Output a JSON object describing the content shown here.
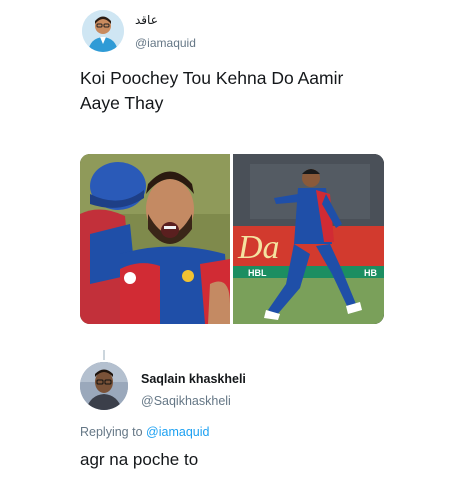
{
  "tweet": {
    "display_name": "عاقد",
    "handle": "@iamaquid",
    "text_line1": "Koi Poochey Tou Kehna Do Aamir",
    "text_line2": "Aaye Thay",
    "media": {
      "left_photo": "cricketer-celebration-photo",
      "right_photo": "bowler-celebration-photo",
      "banner_text": "Da",
      "board_text_left": "HBL",
      "board_text_right": "HB"
    }
  },
  "reply": {
    "display_name": "Saqlain khaskheli",
    "handle": "@Saqikhaskheli",
    "replying_prefix": "Replying to",
    "replying_mention": "@iamaquid",
    "text": "agr na poche to"
  },
  "colors": {
    "text": "#14171a",
    "secondary": "#657786",
    "link": "#1da1f2",
    "kit_blue": "#1f4fa8",
    "kit_red": "#d12b34"
  }
}
